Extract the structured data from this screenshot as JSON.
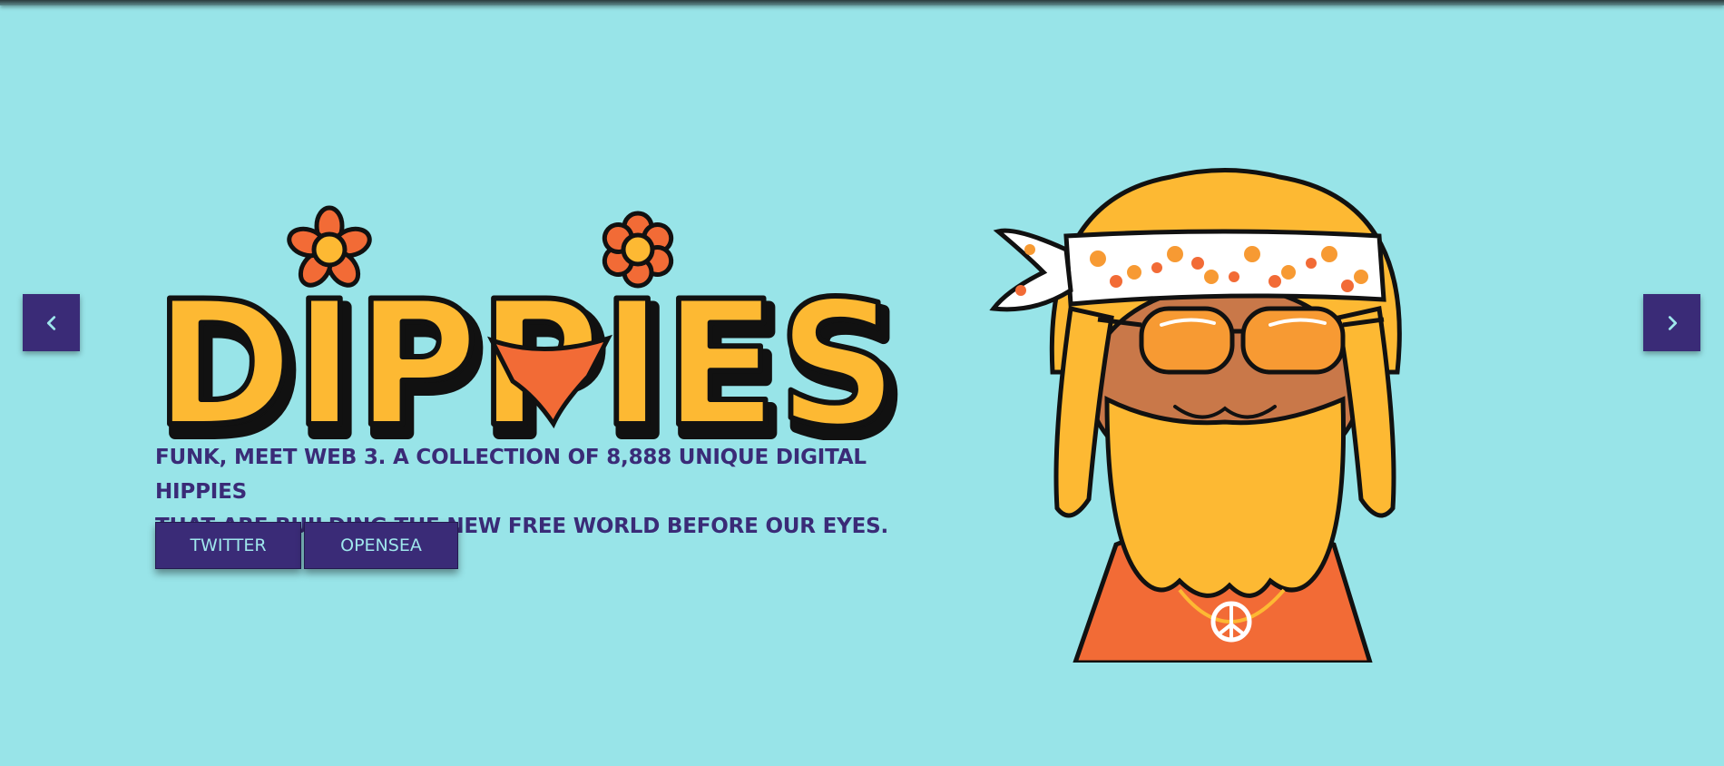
{
  "hero": {
    "logo_text": "DIPPIES",
    "tagline_line1": "FUNK, MEET WEB 3. A COLLECTION OF 8,888 UNIQUE DIGITAL HIPPIES",
    "tagline_line2": "THAT ARE BUILDING THE NEW FREE WORLD BEFORE OUR EYES.",
    "buttons": {
      "twitter": "TWITTER",
      "opensea": "OPENSEA"
    }
  },
  "carousel": {
    "prev_icon": "chevron-left-icon",
    "next_icon": "chevron-right-icon"
  },
  "colors": {
    "background": "#98e4e8",
    "primary": "#3a2b77",
    "button_text": "#9fe7ec",
    "logo_yellow": "#fdb933",
    "flower_orange": "#f26b36",
    "outline": "#111111"
  }
}
